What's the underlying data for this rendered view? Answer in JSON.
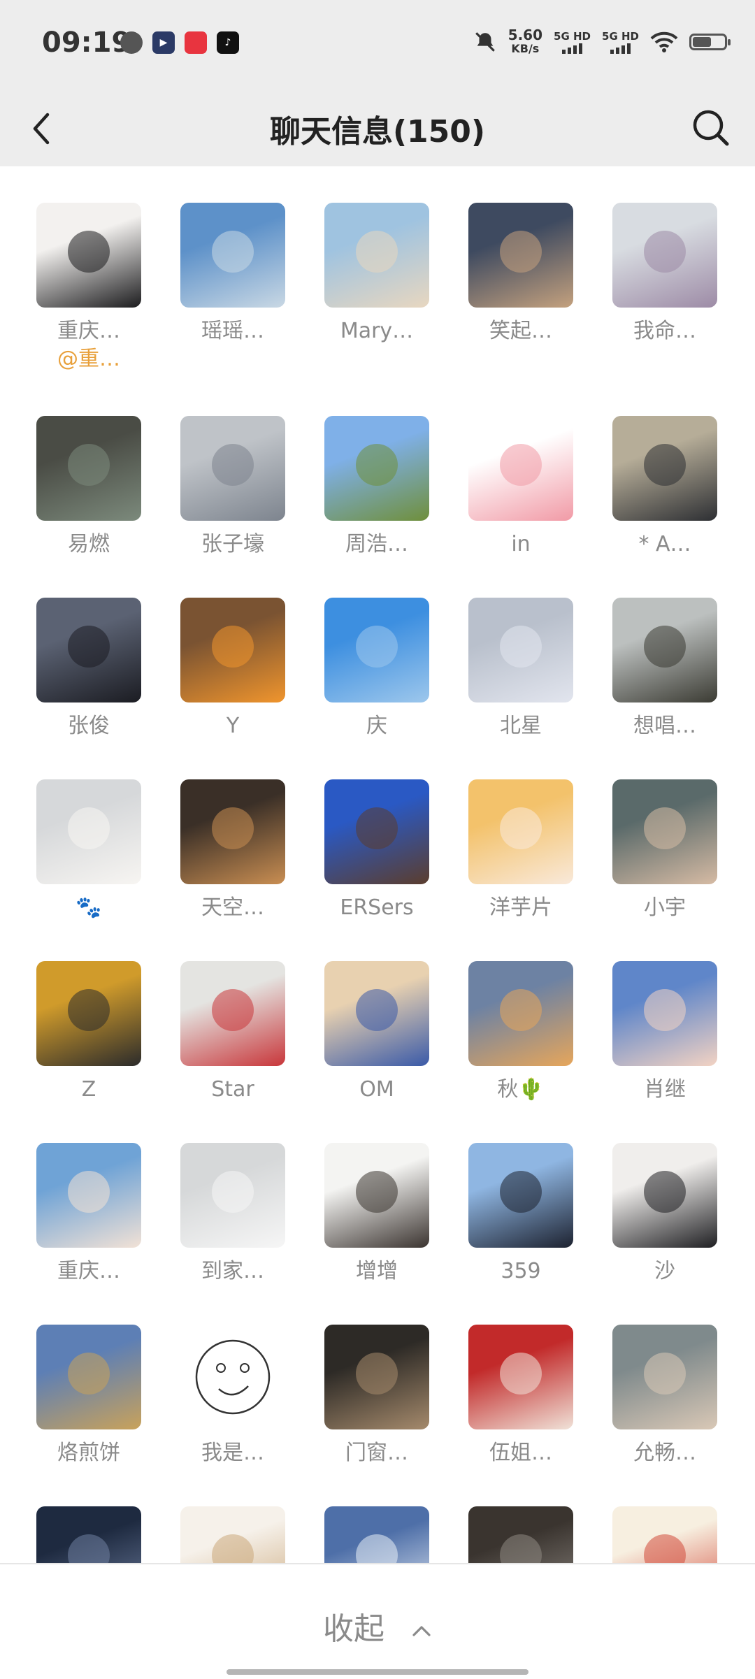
{
  "status_bar": {
    "time": "09:19",
    "net_speed_value": "5.60",
    "net_speed_unit": "KB/s",
    "signal1": "5G HD",
    "signal2": "5G HD",
    "battery_level": 0.6
  },
  "header": {
    "title": "聊天信息(150)"
  },
  "members": [
    {
      "name": "重庆…",
      "sub": "@重…",
      "colors": [
        "#f3f1ef",
        "#1c1c1e"
      ]
    },
    {
      "name": "瑶瑶…",
      "colors": [
        "#5d91c9",
        "#c9d8e4"
      ]
    },
    {
      "name": "Mary…",
      "colors": [
        "#9fc3e0",
        "#e8d7c0"
      ]
    },
    {
      "name": "笑起…",
      "colors": [
        "#3e4a60",
        "#c4a17e"
      ]
    },
    {
      "name": "我命…",
      "colors": [
        "#d8dce1",
        "#9d8ba6"
      ]
    },
    {
      "name": "易燃",
      "colors": [
        "#4a4c45",
        "#7c8a7c"
      ]
    },
    {
      "name": "张子壕",
      "colors": [
        "#bfc3c8",
        "#7d848e"
      ]
    },
    {
      "name": "周浩…",
      "colors": [
        "#7fb0e8",
        "#6f8f3b"
      ]
    },
    {
      "name": "in",
      "colors": [
        "#ffffff",
        "#f19aa6"
      ]
    },
    {
      "name": "* A…",
      "colors": [
        "#b6ad98",
        "#2d2f33"
      ]
    },
    {
      "name": "张俊",
      "colors": [
        "#5b6273",
        "#1b1c22"
      ]
    },
    {
      "name": "Y",
      "colors": [
        "#7a5332",
        "#f0952d"
      ]
    },
    {
      "name": "庆",
      "colors": [
        "#3d8fe0",
        "#9dc7ec"
      ]
    },
    {
      "name": "北星",
      "colors": [
        "#b9c0cc",
        "#e2e5ee"
      ]
    },
    {
      "name": "想唱…",
      "colors": [
        "#bcc0bf",
        "#3b3b33"
      ]
    },
    {
      "name": "🐾",
      "colors": [
        "#d6d8da",
        "#f7f5f2"
      ]
    },
    {
      "name": "天空…",
      "colors": [
        "#3a2f27",
        "#c98e52"
      ]
    },
    {
      "name": "ERSers",
      "colors": [
        "#2a59c4",
        "#5b3d2d"
      ]
    },
    {
      "name": "洋芋片",
      "colors": [
        "#f3c26b",
        "#f9e9da"
      ]
    },
    {
      "name": "小宇",
      "colors": [
        "#5a6a6a",
        "#d6bba4"
      ]
    },
    {
      "name": "Z",
      "colors": [
        "#d09b2b",
        "#2b2b2b"
      ]
    },
    {
      "name": "Star",
      "colors": [
        "#e4e4e1",
        "#c8363a"
      ]
    },
    {
      "name": "OM",
      "colors": [
        "#e8d1b0",
        "#3a5aa8"
      ]
    },
    {
      "name": "秋🌵",
      "colors": [
        "#6d82a3",
        "#e6a65b"
      ]
    },
    {
      "name": "肖继",
      "colors": [
        "#5f86c9",
        "#f3d3c3"
      ]
    },
    {
      "name": "重庆…",
      "colors": [
        "#6fa3d6",
        "#f2e2d6"
      ]
    },
    {
      "name": "到家…",
      "colors": [
        "#d6d8d9",
        "#f6f6f6"
      ]
    },
    {
      "name": "增增",
      "colors": [
        "#f4f4f2",
        "#3b3430"
      ]
    },
    {
      "name": "359",
      "colors": [
        "#8fb6e2",
        "#1d2230"
      ]
    },
    {
      "name": "沙",
      "colors": [
        "#f0eeec",
        "#1f1f22"
      ]
    },
    {
      "name": "烙煎饼",
      "colors": [
        "#5d7fb5",
        "#c9a25a"
      ]
    },
    {
      "name": "我是…",
      "colors": [
        "#ffffff",
        "#ffffff"
      ]
    },
    {
      "name": "门窗…",
      "colors": [
        "#2d2a26",
        "#a58a6c"
      ]
    },
    {
      "name": "伍姐…",
      "colors": [
        "#c22a2a",
        "#f0e2d8"
      ]
    },
    {
      "name": "允畅…",
      "colors": [
        "#7f8a8c",
        "#d9c8b6"
      ]
    },
    {
      "name": "",
      "colors": [
        "#1e2a40",
        "#6f7fa0"
      ]
    },
    {
      "name": "",
      "colors": [
        "#f6f1ea",
        "#caa77a"
      ]
    },
    {
      "name": "",
      "colors": [
        "#4e6fa8",
        "#e8eef6"
      ]
    },
    {
      "name": "",
      "colors": [
        "#3a342f",
        "#8e8882"
      ]
    },
    {
      "name": "",
      "colors": [
        "#f7efe0",
        "#d24a3a"
      ]
    }
  ],
  "footer": {
    "collapse_label": "收起"
  }
}
